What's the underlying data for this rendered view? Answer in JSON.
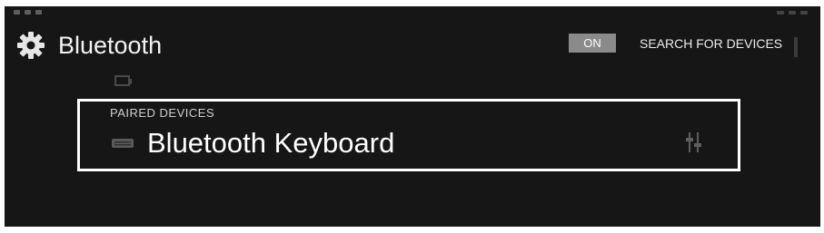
{
  "action_bar": {
    "title": "Bluetooth",
    "toggle_label": "ON",
    "search_label": "SEARCH FOR DEVICES"
  },
  "paired": {
    "header": "PAIRED DEVICES",
    "devices": [
      {
        "name": "Bluetooth Keyboard",
        "icon": "keyboard-icon"
      }
    ]
  },
  "icons": {
    "app": "gear-icon",
    "device_settings": "settings-sliders-icon",
    "overflow": "overflow-menu-icon"
  },
  "colors": {
    "background": "#161616",
    "text": "#ffffff",
    "toggle_bg": "#8a8a8a",
    "highlight": "#ffffff"
  }
}
